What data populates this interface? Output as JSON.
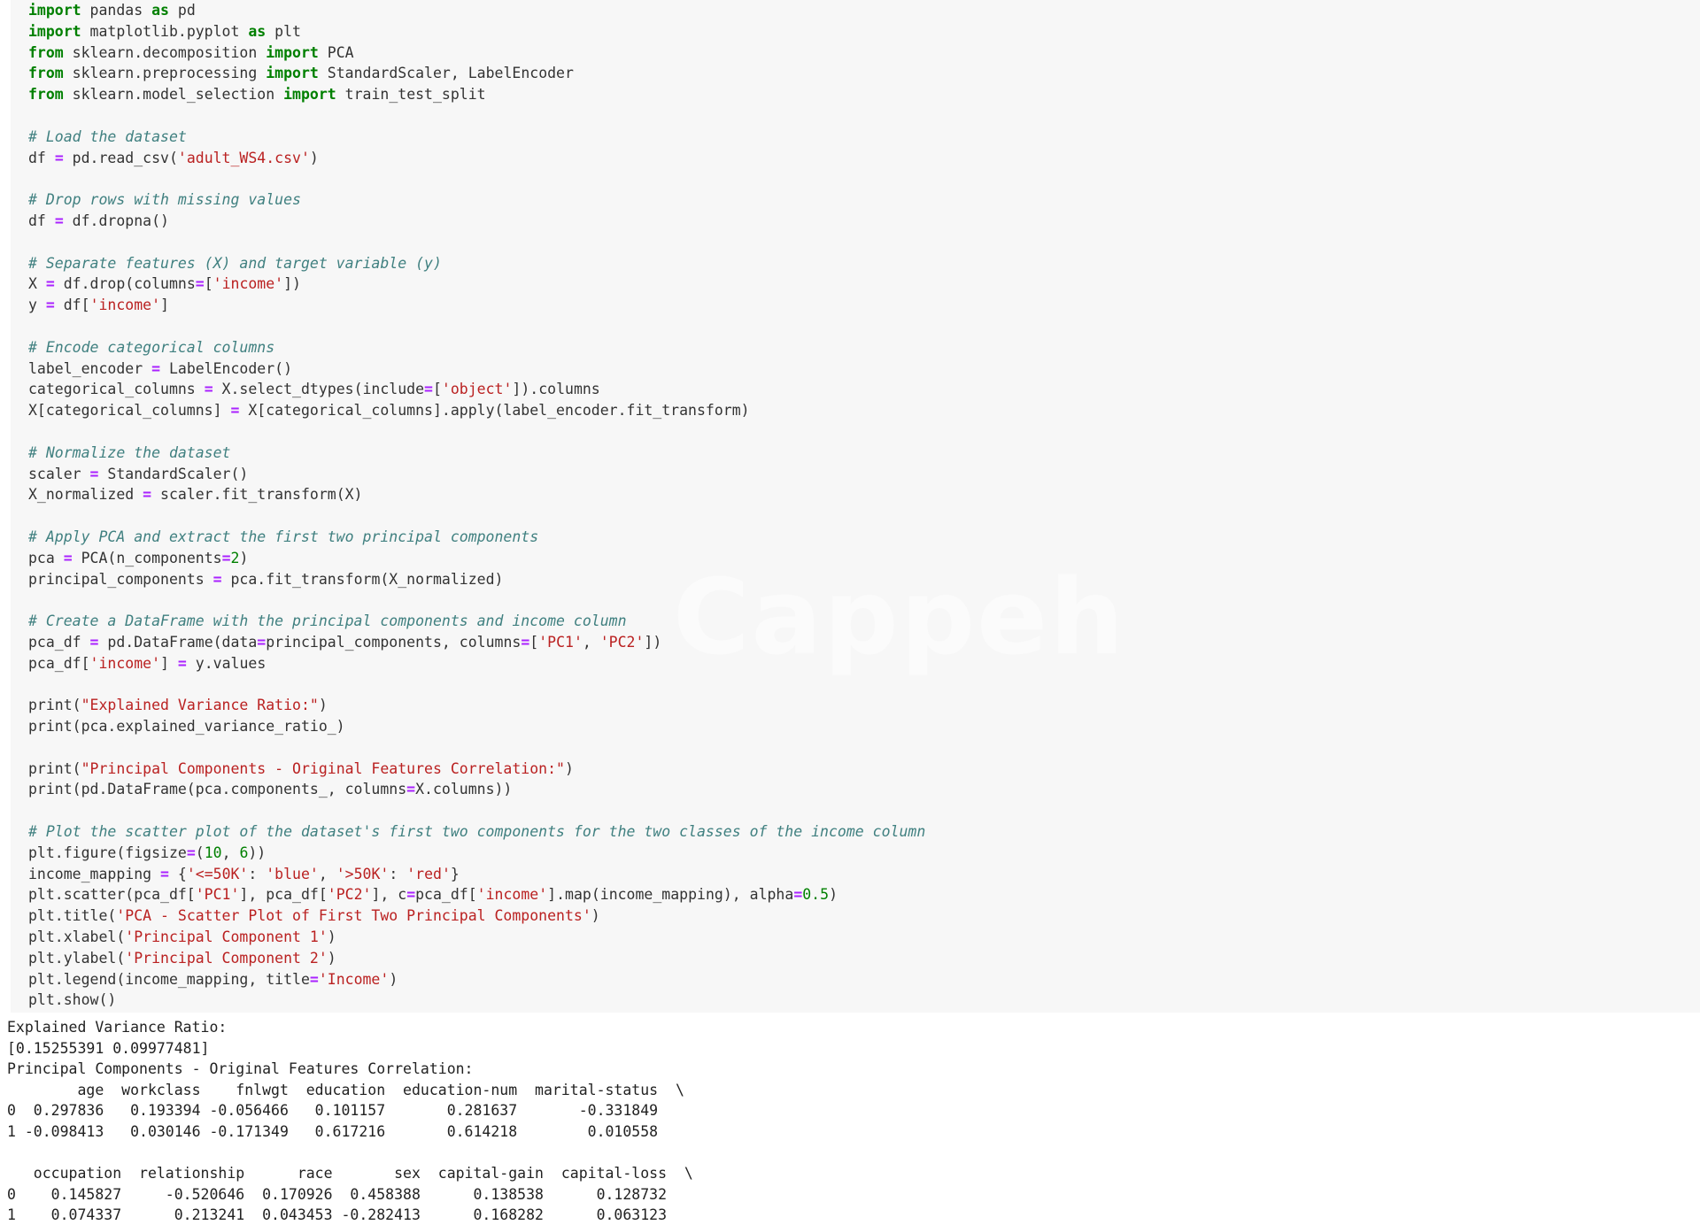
{
  "code": {
    "lines": [
      [
        {
          "t": "kw",
          "v": "import"
        },
        {
          "t": "",
          "v": " pandas "
        },
        {
          "t": "kw",
          "v": "as"
        },
        {
          "t": "",
          "v": " pd"
        }
      ],
      [
        {
          "t": "kw",
          "v": "import"
        },
        {
          "t": "",
          "v": " matplotlib.pyplot "
        },
        {
          "t": "kw",
          "v": "as"
        },
        {
          "t": "",
          "v": " plt"
        }
      ],
      [
        {
          "t": "kw",
          "v": "from"
        },
        {
          "t": "",
          "v": " sklearn.decomposition "
        },
        {
          "t": "kw",
          "v": "import"
        },
        {
          "t": "",
          "v": " PCA"
        }
      ],
      [
        {
          "t": "kw",
          "v": "from"
        },
        {
          "t": "",
          "v": " sklearn.preprocessing "
        },
        {
          "t": "kw",
          "v": "import"
        },
        {
          "t": "",
          "v": " StandardScaler, LabelEncoder"
        }
      ],
      [
        {
          "t": "kw",
          "v": "from"
        },
        {
          "t": "",
          "v": " sklearn.model_selection "
        },
        {
          "t": "kw",
          "v": "import"
        },
        {
          "t": "",
          "v": " train_test_split"
        }
      ],
      [],
      [
        {
          "t": "cm",
          "v": "# Load the dataset"
        }
      ],
      [
        {
          "t": "",
          "v": "df "
        },
        {
          "t": "op",
          "v": "="
        },
        {
          "t": "",
          "v": " pd.read_csv("
        },
        {
          "t": "st",
          "v": "'adult_WS4.csv'"
        },
        {
          "t": "",
          "v": ")"
        }
      ],
      [],
      [
        {
          "t": "cm",
          "v": "# Drop rows with missing values"
        }
      ],
      [
        {
          "t": "",
          "v": "df "
        },
        {
          "t": "op",
          "v": "="
        },
        {
          "t": "",
          "v": " df.dropna()"
        }
      ],
      [],
      [
        {
          "t": "cm",
          "v": "# Separate features (X) and target variable (y)"
        }
      ],
      [
        {
          "t": "",
          "v": "X "
        },
        {
          "t": "op",
          "v": "="
        },
        {
          "t": "",
          "v": " df.drop(columns"
        },
        {
          "t": "op",
          "v": "="
        },
        {
          "t": "",
          "v": "["
        },
        {
          "t": "st",
          "v": "'income'"
        },
        {
          "t": "",
          "v": "])"
        }
      ],
      [
        {
          "t": "",
          "v": "y "
        },
        {
          "t": "op",
          "v": "="
        },
        {
          "t": "",
          "v": " df["
        },
        {
          "t": "st",
          "v": "'income'"
        },
        {
          "t": "",
          "v": "]"
        }
      ],
      [],
      [
        {
          "t": "cm",
          "v": "# Encode categorical columns"
        }
      ],
      [
        {
          "t": "",
          "v": "label_encoder "
        },
        {
          "t": "op",
          "v": "="
        },
        {
          "t": "",
          "v": " LabelEncoder()"
        }
      ],
      [
        {
          "t": "",
          "v": "categorical_columns "
        },
        {
          "t": "op",
          "v": "="
        },
        {
          "t": "",
          "v": " X.select_dtypes(include"
        },
        {
          "t": "op",
          "v": "="
        },
        {
          "t": "",
          "v": "["
        },
        {
          "t": "st",
          "v": "'object'"
        },
        {
          "t": "",
          "v": "]).columns"
        }
      ],
      [
        {
          "t": "",
          "v": "X[categorical_columns] "
        },
        {
          "t": "op",
          "v": "="
        },
        {
          "t": "",
          "v": " X[categorical_columns].apply(label_encoder.fit_transform)"
        }
      ],
      [],
      [
        {
          "t": "cm",
          "v": "# Normalize the dataset"
        }
      ],
      [
        {
          "t": "",
          "v": "scaler "
        },
        {
          "t": "op",
          "v": "="
        },
        {
          "t": "",
          "v": " StandardScaler()"
        }
      ],
      [
        {
          "t": "",
          "v": "X_normalized "
        },
        {
          "t": "op",
          "v": "="
        },
        {
          "t": "",
          "v": " scaler.fit_transform(X)"
        }
      ],
      [],
      [
        {
          "t": "cm",
          "v": "# Apply PCA and extract the first two principal components"
        }
      ],
      [
        {
          "t": "",
          "v": "pca "
        },
        {
          "t": "op",
          "v": "="
        },
        {
          "t": "",
          "v": " PCA(n_components"
        },
        {
          "t": "op",
          "v": "="
        },
        {
          "t": "nm",
          "v": "2"
        },
        {
          "t": "",
          "v": ")"
        }
      ],
      [
        {
          "t": "",
          "v": "principal_components "
        },
        {
          "t": "op",
          "v": "="
        },
        {
          "t": "",
          "v": " pca.fit_transform(X_normalized)"
        }
      ],
      [],
      [
        {
          "t": "cm",
          "v": "# Create a DataFrame with the principal components and income column"
        }
      ],
      [
        {
          "t": "",
          "v": "pca_df "
        },
        {
          "t": "op",
          "v": "="
        },
        {
          "t": "",
          "v": " pd.DataFrame(data"
        },
        {
          "t": "op",
          "v": "="
        },
        {
          "t": "",
          "v": "principal_components, columns"
        },
        {
          "t": "op",
          "v": "="
        },
        {
          "t": "",
          "v": "["
        },
        {
          "t": "st",
          "v": "'PC1'"
        },
        {
          "t": "",
          "v": ", "
        },
        {
          "t": "st",
          "v": "'PC2'"
        },
        {
          "t": "",
          "v": "])"
        }
      ],
      [
        {
          "t": "",
          "v": "pca_df["
        },
        {
          "t": "st",
          "v": "'income'"
        },
        {
          "t": "",
          "v": "] "
        },
        {
          "t": "op",
          "v": "="
        },
        {
          "t": "",
          "v": " y.values"
        }
      ],
      [],
      [
        {
          "t": "",
          "v": "print("
        },
        {
          "t": "st",
          "v": "\"Explained Variance Ratio:\""
        },
        {
          "t": "",
          "v": ")"
        }
      ],
      [
        {
          "t": "",
          "v": "print(pca.explained_variance_ratio_)"
        }
      ],
      [],
      [
        {
          "t": "",
          "v": "print("
        },
        {
          "t": "st",
          "v": "\"Principal Components - Original Features Correlation:\""
        },
        {
          "t": "",
          "v": ")"
        }
      ],
      [
        {
          "t": "",
          "v": "print(pd.DataFrame(pca.components_, columns"
        },
        {
          "t": "op",
          "v": "="
        },
        {
          "t": "",
          "v": "X.columns))"
        }
      ],
      [],
      [
        {
          "t": "cm",
          "v": "# Plot the scatter plot of the dataset's first two components for the two classes of the income column"
        }
      ],
      [
        {
          "t": "",
          "v": "plt.figure(figsize"
        },
        {
          "t": "op",
          "v": "="
        },
        {
          "t": "",
          "v": "("
        },
        {
          "t": "nm",
          "v": "10"
        },
        {
          "t": "",
          "v": ", "
        },
        {
          "t": "nm",
          "v": "6"
        },
        {
          "t": "",
          "v": "))"
        }
      ],
      [
        {
          "t": "",
          "v": "income_mapping "
        },
        {
          "t": "op",
          "v": "="
        },
        {
          "t": "",
          "v": " {"
        },
        {
          "t": "st",
          "v": "'<=50K'"
        },
        {
          "t": "",
          "v": ": "
        },
        {
          "t": "st",
          "v": "'blue'"
        },
        {
          "t": "",
          "v": ", "
        },
        {
          "t": "st",
          "v": "'>50K'"
        },
        {
          "t": "",
          "v": ": "
        },
        {
          "t": "st",
          "v": "'red'"
        },
        {
          "t": "",
          "v": "}"
        }
      ],
      [
        {
          "t": "",
          "v": "plt.scatter(pca_df["
        },
        {
          "t": "st",
          "v": "'PC1'"
        },
        {
          "t": "",
          "v": "], pca_df["
        },
        {
          "t": "st",
          "v": "'PC2'"
        },
        {
          "t": "",
          "v": "], c"
        },
        {
          "t": "op",
          "v": "="
        },
        {
          "t": "",
          "v": "pca_df["
        },
        {
          "t": "st",
          "v": "'income'"
        },
        {
          "t": "",
          "v": "].map(income_mapping), alpha"
        },
        {
          "t": "op",
          "v": "="
        },
        {
          "t": "nm",
          "v": "0.5"
        },
        {
          "t": "",
          "v": ")"
        }
      ],
      [
        {
          "t": "",
          "v": "plt.title("
        },
        {
          "t": "st",
          "v": "'PCA - Scatter Plot of First Two Principal Components'"
        },
        {
          "t": "",
          "v": ")"
        }
      ],
      [
        {
          "t": "",
          "v": "plt.xlabel("
        },
        {
          "t": "st",
          "v": "'Principal Component 1'"
        },
        {
          "t": "",
          "v": ")"
        }
      ],
      [
        {
          "t": "",
          "v": "plt.ylabel("
        },
        {
          "t": "st",
          "v": "'Principal Component 2'"
        },
        {
          "t": "",
          "v": ")"
        }
      ],
      [
        {
          "t": "",
          "v": "plt.legend(income_mapping, title"
        },
        {
          "t": "op",
          "v": "="
        },
        {
          "t": "st",
          "v": "'Income'"
        },
        {
          "t": "",
          "v": ")"
        }
      ],
      [
        {
          "t": "",
          "v": "plt.show()"
        }
      ]
    ]
  },
  "output": {
    "text": "Explained Variance Ratio:\n[0.15255391 0.09977481]\nPrincipal Components - Original Features Correlation:\n        age  workclass    fnlwgt  education  education-num  marital-status  \\\n0  0.297836   0.193394 -0.056466   0.101157       0.281637       -0.331849   \n1 -0.098413   0.030146 -0.171349   0.617216       0.614218        0.010558   \n\n   occupation  relationship      race       sex  capital-gain  capital-loss  \\\n0    0.145827     -0.520646  0.170926  0.458388      0.138538      0.128732   \n1    0.074337      0.213241  0.043453 -0.282413      0.168282      0.063123   "
  },
  "watermark": "Cappeh"
}
